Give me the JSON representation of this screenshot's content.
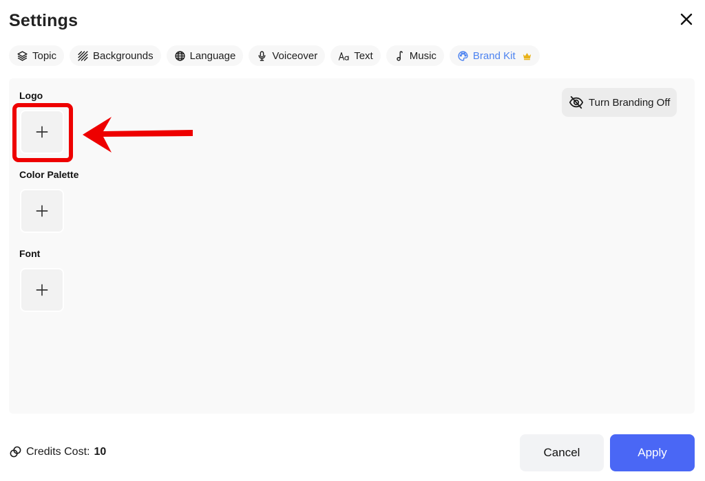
{
  "header": {
    "title": "Settings",
    "close_icon": "close-icon"
  },
  "tabs": [
    {
      "label": "Topic",
      "icon": "layers-icon",
      "active": false
    },
    {
      "label": "Backgrounds",
      "icon": "hatch-pattern-icon",
      "active": false
    },
    {
      "label": "Language",
      "icon": "globe-icon",
      "active": false
    },
    {
      "label": "Voiceover",
      "icon": "microphone-icon",
      "active": false
    },
    {
      "label": "Text",
      "icon": "text-aa-icon",
      "active": false
    },
    {
      "label": "Music",
      "icon": "music-note-icon",
      "active": false
    },
    {
      "label": "Brand Kit",
      "icon": "palette-icon",
      "active": true,
      "badge": "crown-icon"
    }
  ],
  "brand_kit": {
    "sections": [
      {
        "label": "Logo",
        "add_icon": "plus-icon"
      },
      {
        "label": "Color Palette",
        "add_icon": "plus-icon"
      },
      {
        "label": "Font",
        "add_icon": "plus-icon"
      }
    ],
    "branding_toggle_label": "Turn Branding Off",
    "branding_toggle_icon": "eye-off-icon"
  },
  "annotation": {
    "highlight_target": "Logo add button",
    "highlight_color": "#ee0000"
  },
  "footer": {
    "credits_label": "Credits Cost:",
    "credits_value": "10",
    "cancel_label": "Cancel",
    "apply_label": "Apply"
  },
  "colors": {
    "accent": "#4a67f5",
    "active_tab": "#4d83f0",
    "crown": "#e8b21a"
  }
}
